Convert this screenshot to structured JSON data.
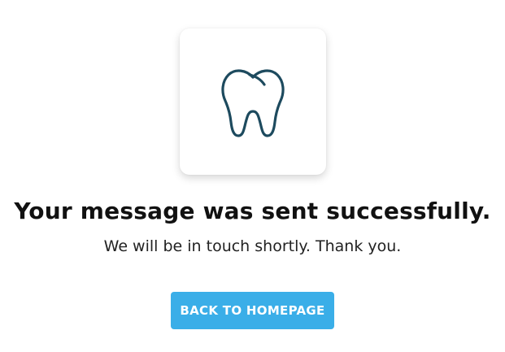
{
  "confirmation": {
    "icon": "tooth-icon",
    "heading": "Your message was sent successfully.",
    "subtext": "We will be in touch shortly. Thank you.",
    "button_label": "BACK TO HOMEPAGE"
  },
  "colors": {
    "icon_stroke": "#1d4a5e",
    "button_background": "#3aaee8",
    "button_text": "#ffffff",
    "heading_text": "#111111"
  }
}
